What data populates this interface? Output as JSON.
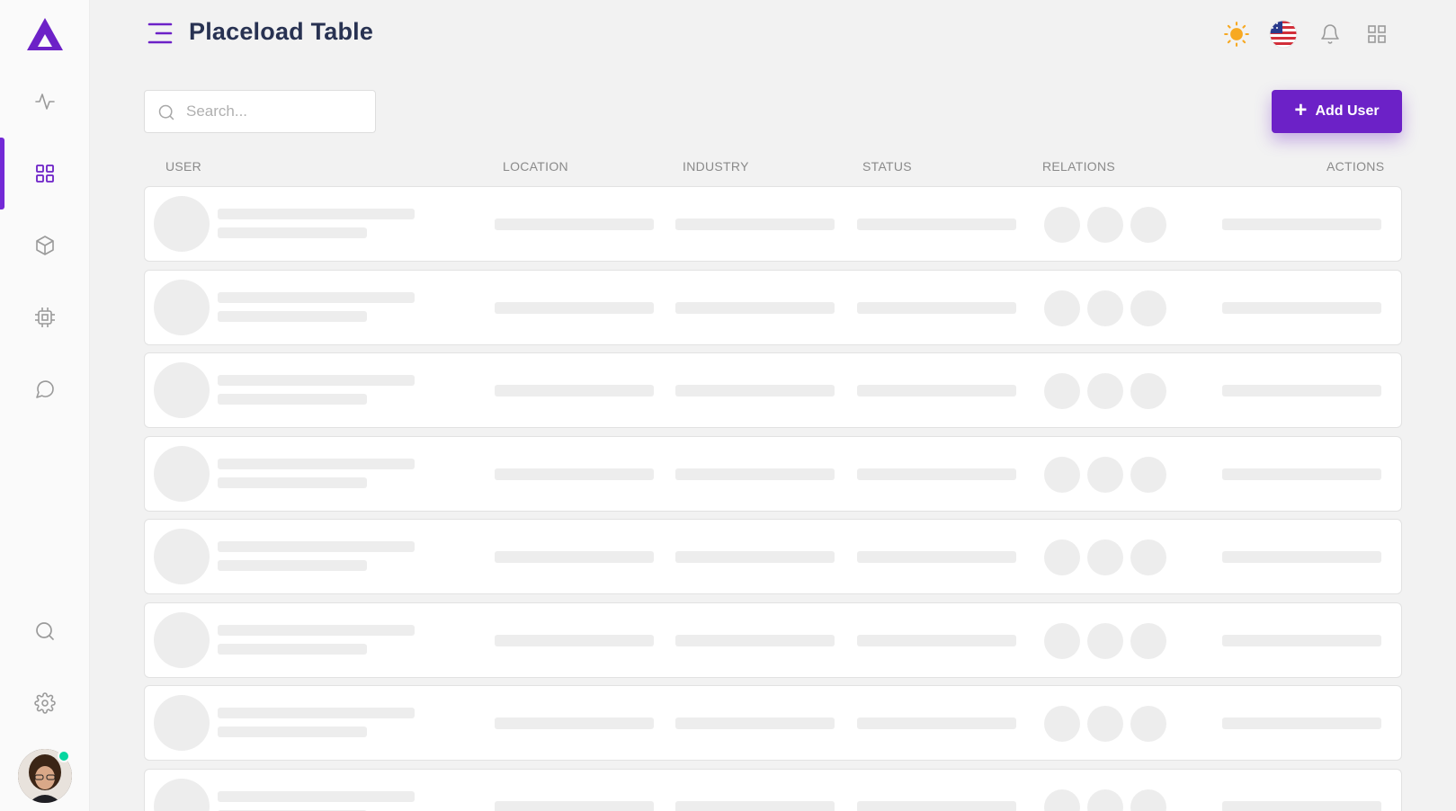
{
  "header": {
    "title": "Placeload Table"
  },
  "search": {
    "placeholder": "Search..."
  },
  "toolbar": {
    "add_user_label": "Add User"
  },
  "table": {
    "columns": [
      "USER",
      "LOCATION",
      "INDUSTRY",
      "STATUS",
      "RELATIONS",
      "ACTIONS"
    ],
    "placeholder_rows": 8
  },
  "sidebar": {
    "items": [
      {
        "name": "activity-icon"
      },
      {
        "name": "grid-icon",
        "active": true
      },
      {
        "name": "box-icon"
      },
      {
        "name": "cpu-icon"
      },
      {
        "name": "chat-icon"
      }
    ],
    "bottom": [
      {
        "name": "search-icon"
      },
      {
        "name": "gear-icon"
      }
    ]
  },
  "topbar_icons": [
    "sun-icon",
    "us-flag-icon",
    "bell-icon",
    "apps-grid-icon"
  ],
  "colors": {
    "accent": "#6c21c7",
    "online": "#06d6a0",
    "sun": "#f7a922"
  }
}
